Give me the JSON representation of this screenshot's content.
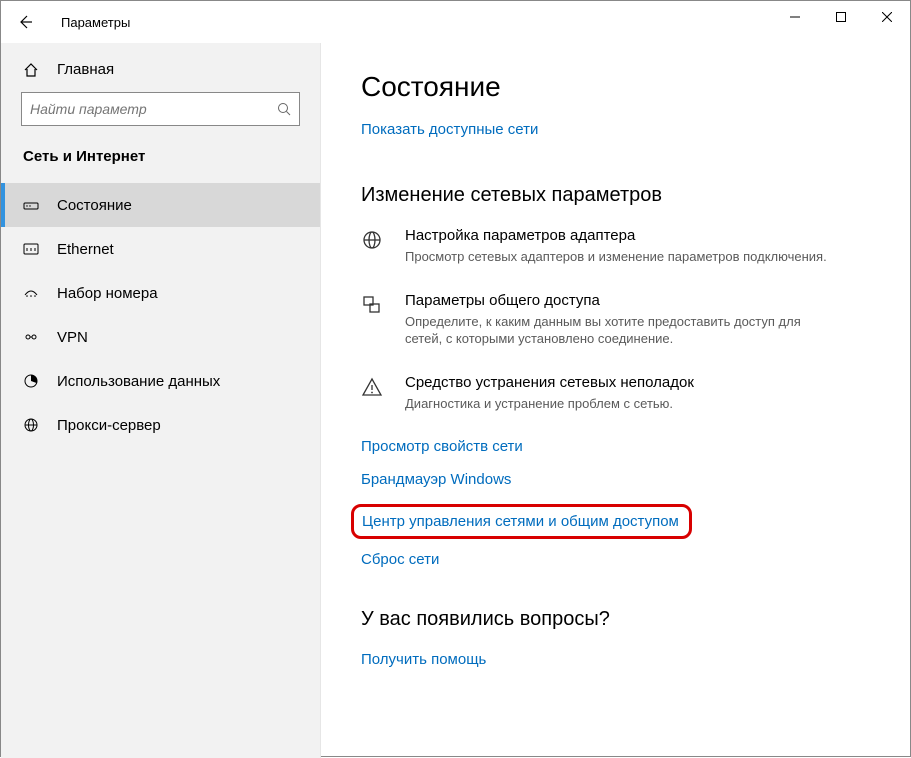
{
  "window": {
    "title": "Параметры"
  },
  "sidebar": {
    "home_label": "Главная",
    "search_placeholder": "Найти параметр",
    "category": "Сеть и Интернет",
    "items": [
      {
        "label": "Состояние",
        "icon": "status"
      },
      {
        "label": "Ethernet",
        "icon": "ethernet"
      },
      {
        "label": "Набор номера",
        "icon": "dialup"
      },
      {
        "label": "VPN",
        "icon": "vpn"
      },
      {
        "label": "Использование данных",
        "icon": "datausage"
      },
      {
        "label": "Прокси-сервер",
        "icon": "proxy"
      }
    ]
  },
  "content": {
    "page_title": "Состояние",
    "show_networks": "Показать доступные сети",
    "change_settings_title": "Изменение сетевых параметров",
    "options": [
      {
        "title": "Настройка параметров адаптера",
        "desc": "Просмотр сетевых адаптеров и изменение параметров подключения."
      },
      {
        "title": "Параметры общего доступа",
        "desc": "Определите, к каким данным вы хотите предоставить доступ для сетей, с которыми установлено соединение."
      },
      {
        "title": "Средство устранения сетевых неполадок",
        "desc": "Диагностика и устранение проблем с сетью."
      }
    ],
    "links": {
      "view_props": "Просмотр свойств сети",
      "firewall": "Брандмауэр Windows",
      "sharing_center": "Центр управления сетями и общим доступом",
      "reset": "Сброс сети"
    },
    "help_title": "У вас появились вопросы?",
    "get_help": "Получить помощь"
  }
}
